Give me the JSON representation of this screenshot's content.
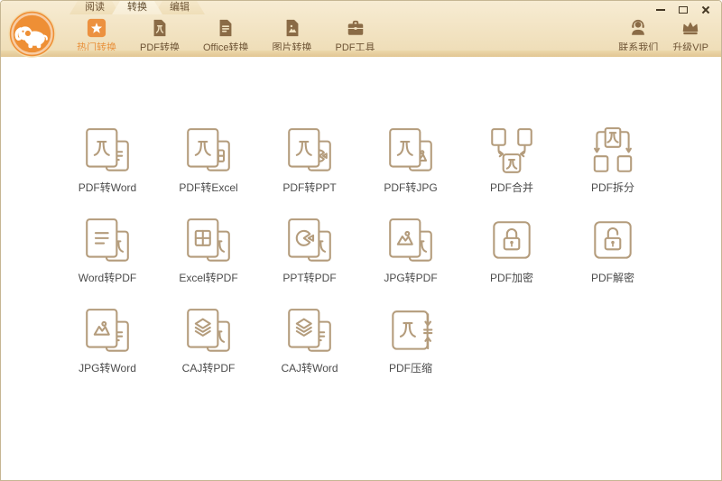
{
  "tabs": [
    {
      "name": "tab-read",
      "label": "阅读",
      "active": false
    },
    {
      "name": "tab-convert",
      "label": "转换",
      "active": true
    },
    {
      "name": "tab-edit",
      "label": "编辑",
      "active": false
    }
  ],
  "window_controls": [
    {
      "name": "minimize-button",
      "icon": "minimize-icon"
    },
    {
      "name": "maximize-button",
      "icon": "maximize-icon"
    },
    {
      "name": "close-button",
      "icon": "close-icon"
    }
  ],
  "toolbar": {
    "items": [
      {
        "name": "toolbar-hot-convert",
        "label": "热门转换",
        "icon": "hot-star-icon",
        "active": true
      },
      {
        "name": "toolbar-pdf-convert",
        "label": "PDF转换",
        "icon": "pdf-doc-icon",
        "active": false
      },
      {
        "name": "toolbar-office-convert",
        "label": "Office转换",
        "icon": "office-doc-icon",
        "active": false
      },
      {
        "name": "toolbar-image-convert",
        "label": "图片转换",
        "icon": "image-doc-icon",
        "active": false
      },
      {
        "name": "toolbar-pdf-tools",
        "label": "PDF工具",
        "icon": "briefcase-icon",
        "active": false
      }
    ]
  },
  "header_actions": [
    {
      "name": "contact-us-button",
      "label": "联系我们",
      "icon": "headset-icon"
    },
    {
      "name": "upgrade-vip-button",
      "label": "升级VIP",
      "icon": "crown-icon"
    }
  ],
  "grid": {
    "items": [
      {
        "name": "pdf-to-word",
        "label": "PDF转Word",
        "icon": "pdf-to-word-icon"
      },
      {
        "name": "pdf-to-excel",
        "label": "PDF转Excel",
        "icon": "pdf-to-excel-icon"
      },
      {
        "name": "pdf-to-ppt",
        "label": "PDF转PPT",
        "icon": "pdf-to-ppt-icon"
      },
      {
        "name": "pdf-to-jpg",
        "label": "PDF转JPG",
        "icon": "pdf-to-jpg-icon"
      },
      {
        "name": "pdf-merge",
        "label": "PDF合并",
        "icon": "pdf-merge-icon"
      },
      {
        "name": "pdf-split",
        "label": "PDF拆分",
        "icon": "pdf-split-icon"
      },
      {
        "name": "word-to-pdf",
        "label": "Word转PDF",
        "icon": "word-to-pdf-icon"
      },
      {
        "name": "excel-to-pdf",
        "label": "Excel转PDF",
        "icon": "excel-to-pdf-icon"
      },
      {
        "name": "ppt-to-pdf",
        "label": "PPT转PDF",
        "icon": "ppt-to-pdf-icon"
      },
      {
        "name": "jpg-to-pdf",
        "label": "JPG转PDF",
        "icon": "jpg-to-pdf-icon"
      },
      {
        "name": "pdf-encrypt",
        "label": "PDF加密",
        "icon": "pdf-lock-icon"
      },
      {
        "name": "pdf-decrypt",
        "label": "PDF解密",
        "icon": "pdf-unlock-icon"
      },
      {
        "name": "jpg-to-word",
        "label": "JPG转Word",
        "icon": "jpg-to-word-icon"
      },
      {
        "name": "caj-to-pdf",
        "label": "CAJ转PDF",
        "icon": "caj-to-pdf-icon"
      },
      {
        "name": "caj-to-word",
        "label": "CAJ转Word",
        "icon": "caj-to-word-icon"
      },
      {
        "name": "pdf-compress",
        "label": "PDF压缩",
        "icon": "pdf-compress-icon"
      }
    ]
  },
  "colors": {
    "header_beige": "#f2e3c2",
    "accent_band": "#e2c693",
    "active_orange": "#e8913c",
    "toolbar_brown": "#8a6b46",
    "grid_icon_stroke": "#b49c7c",
    "grid_label_gray": "#4c4c4c",
    "logo_orange": "#ee8f35"
  }
}
